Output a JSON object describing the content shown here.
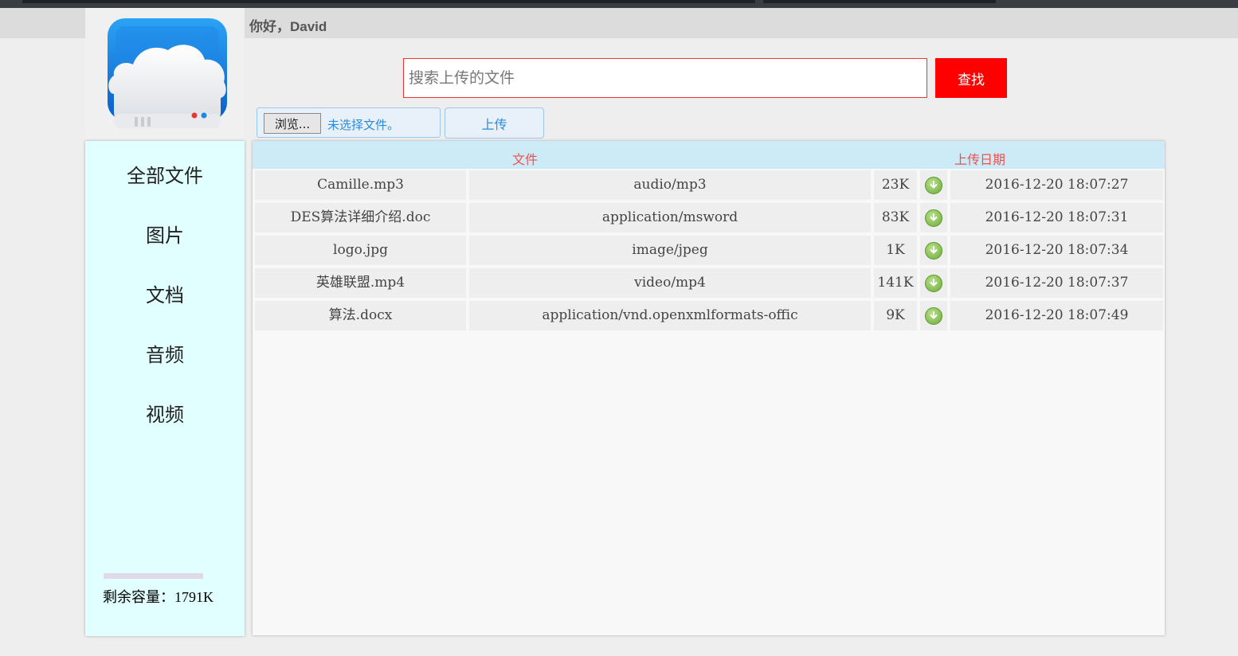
{
  "header": {
    "greeting": "你好，David"
  },
  "search": {
    "placeholder": "搜索上传的文件",
    "value": "",
    "button_label": "查找"
  },
  "upload": {
    "browse_label": "浏览...",
    "file_status": "未选择文件。",
    "upload_label": "上传"
  },
  "sidebar": {
    "items": [
      {
        "label": "全部文件"
      },
      {
        "label": "图片"
      },
      {
        "label": "文档"
      },
      {
        "label": "音频"
      },
      {
        "label": "视频"
      }
    ],
    "capacity_text": "剩余容量：1791K"
  },
  "table": {
    "headers": {
      "file": "文件",
      "date": "上传日期"
    },
    "rows": [
      {
        "name": "Camille.mp3",
        "type": "audio/mp3",
        "size": "23K",
        "date": "2016-12-20 18:07:27"
      },
      {
        "name": "DES算法详细介绍.doc",
        "type": "application/msword",
        "size": "83K",
        "date": "2016-12-20 18:07:31"
      },
      {
        "name": "logo.jpg",
        "type": "image/jpeg",
        "size": "1K",
        "date": "2016-12-20 18:07:34"
      },
      {
        "name": "英雄联盟.mp4",
        "type": "video/mp4",
        "size": "141K",
        "date": "2016-12-20 18:07:37"
      },
      {
        "name": "算法.docx",
        "type": "application/vnd.openxmlformats-offic",
        "size": "9K",
        "date": "2016-12-20 18:07:49"
      }
    ]
  },
  "colors": {
    "accent_red": "#ff0000",
    "sidebar_bg": "#e0fffe",
    "table_header_bg": "#cdebf7",
    "header_text": "#ee5050",
    "link_blue": "#2b8bdc"
  },
  "icons": {
    "logo": "cloud-drive-logo",
    "download": "download-arrow-icon"
  }
}
